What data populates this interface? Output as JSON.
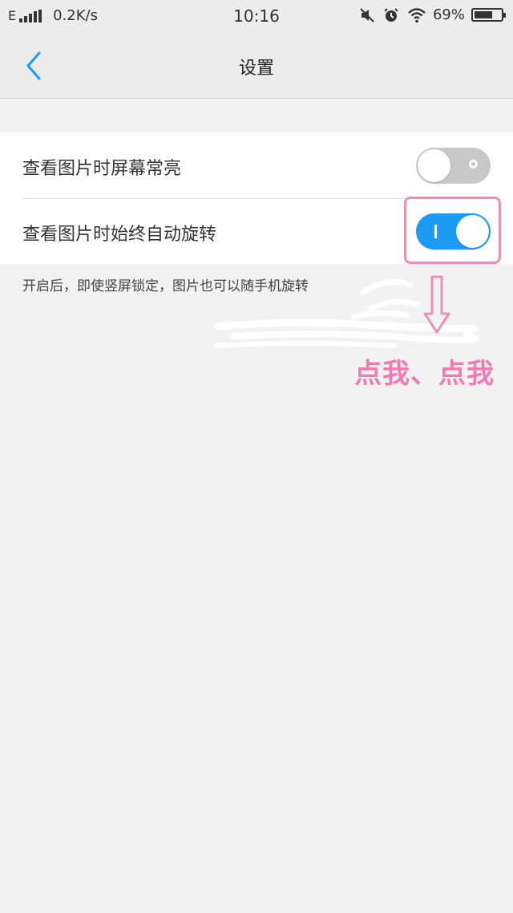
{
  "status_bar": {
    "network_type": "E",
    "speed": "0.2K/s",
    "time": "10:16",
    "battery_percent": "69%",
    "battery_level": 0.69,
    "icons": [
      "signal-icon",
      "mute-icon",
      "alarm-icon",
      "wifi-icon",
      "battery-icon"
    ]
  },
  "header": {
    "title": "设置",
    "back_icon": "chevron-left-icon"
  },
  "settings": [
    {
      "label": "查看图片时屏幕常亮",
      "enabled": false
    },
    {
      "label": "查看图片时始终自动旋转",
      "enabled": true
    }
  ],
  "hint": "开启后，即使竖屏锁定，图片也可以随手机旋转",
  "annotation": {
    "text": "点我、点我",
    "color": "#f37ab0"
  },
  "colors": {
    "accent": "#1b9cf2",
    "toggle_off": "#c8c8c8",
    "annotation_box": "#f08fb6"
  }
}
